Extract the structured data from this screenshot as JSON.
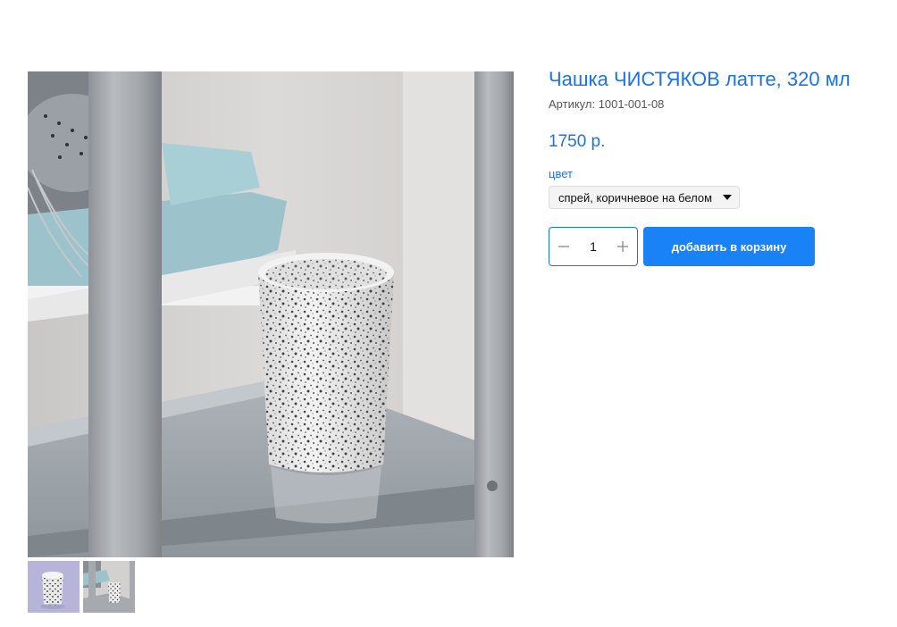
{
  "product": {
    "title": "Чашка ЧИСТЯКОВ латте, 320 мл",
    "sku": "Артикул: 1001-001-08",
    "price": "1750 р."
  },
  "option": {
    "label": "цвет",
    "selected": "спрей, коричневое на белом"
  },
  "cart": {
    "quantity": "1",
    "add_label": "добавить в корзину"
  },
  "gallery": {
    "thumbnail_count": 2,
    "active_index": 0
  },
  "colors": {
    "accent": "#1a73e8",
    "button": "#1a82f7"
  }
}
